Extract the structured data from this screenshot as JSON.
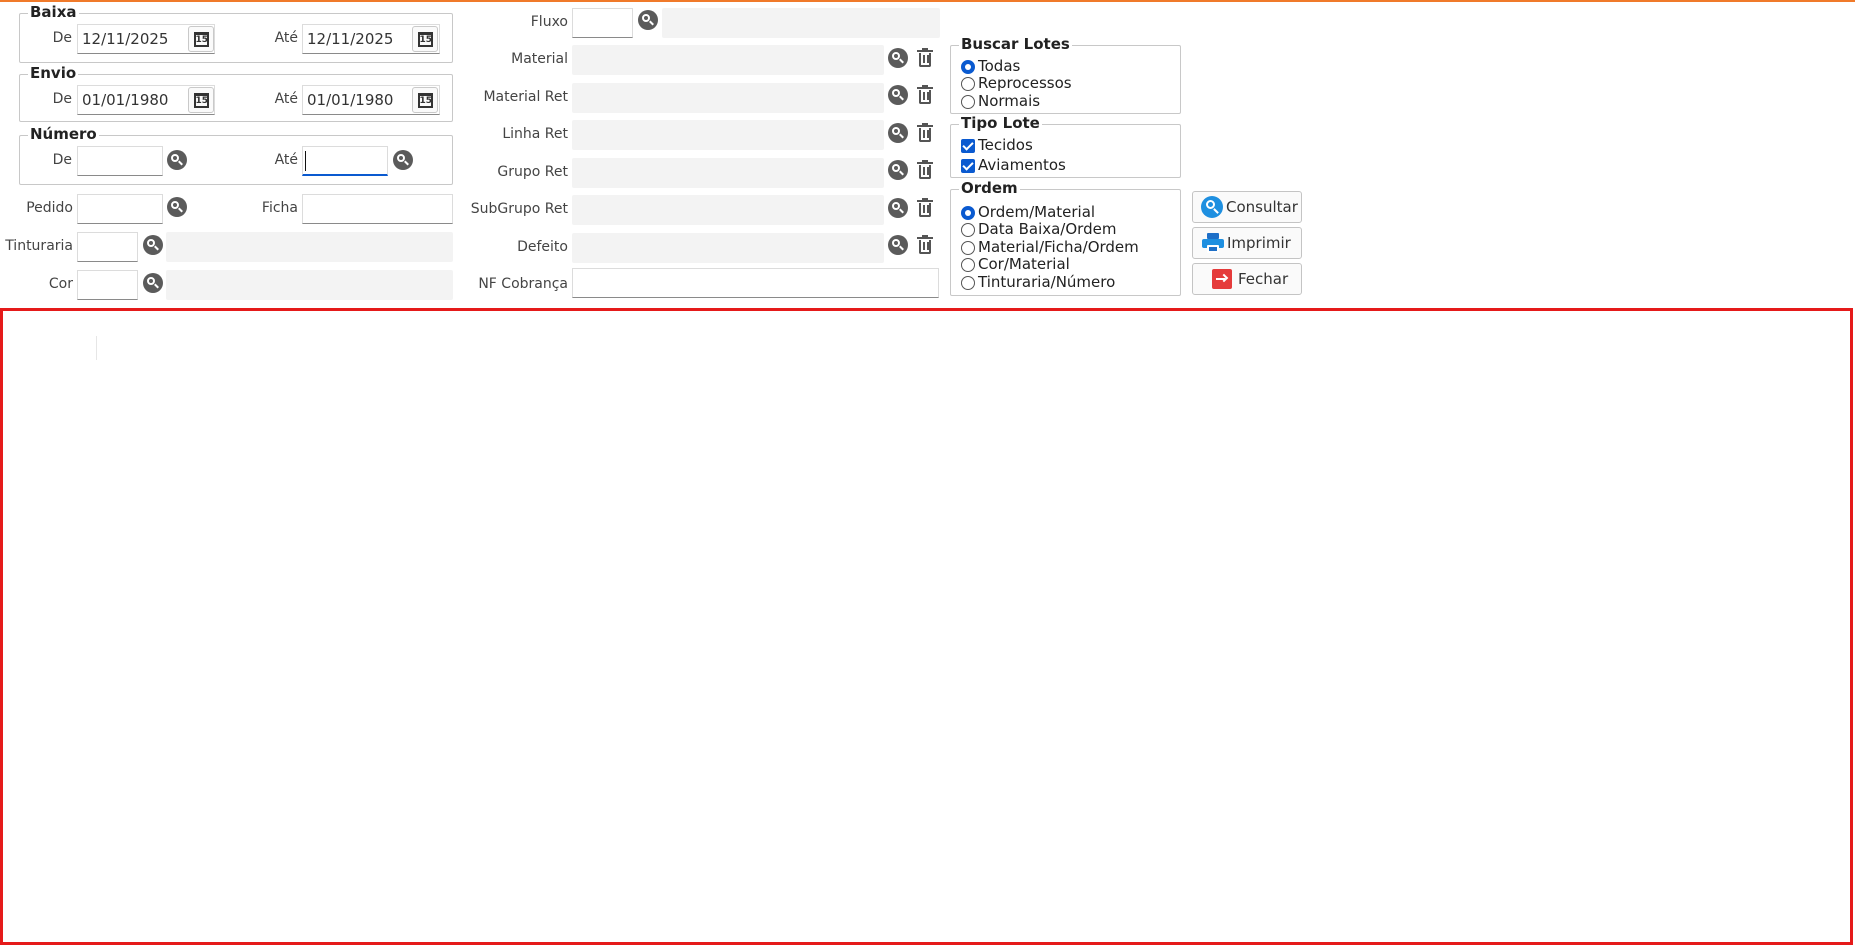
{
  "baixa": {
    "title": "Baixa",
    "de_label": "De",
    "de_value": "12/11/2025",
    "ate_label": "Até",
    "ate_value": "12/11/2025"
  },
  "envio": {
    "title": "Envio",
    "de_label": "De",
    "de_value": "01/01/1980",
    "ate_label": "Até",
    "ate_value": "01/01/1980"
  },
  "numero": {
    "title": "Número",
    "de_label": "De",
    "de_value": "",
    "ate_label": "Até",
    "ate_value": ""
  },
  "calendar_glyph": "15",
  "left_fields": {
    "pedido_label": "Pedido",
    "pedido_value": "",
    "ficha_label": "Ficha",
    "ficha_value": "",
    "tinturaria_label": "Tinturaria",
    "tinturaria_value": "",
    "cor_label": "Cor",
    "cor_value": ""
  },
  "middle_fields": {
    "fluxo_label": "Fluxo",
    "fluxo_value": "",
    "material_label": "Material",
    "material_ret_label": "Material Ret",
    "linha_ret_label": "Linha Ret",
    "grupo_ret_label": "Grupo Ret",
    "subgrupo_ret_label": "SubGrupo Ret",
    "defeito_label": "Defeito",
    "nf_cobranca_label": "NF Cobrança",
    "nf_cobranca_value": ""
  },
  "buscar_lotes": {
    "title": "Buscar Lotes",
    "options": [
      "Todas",
      "Reprocessos",
      "Normais"
    ],
    "selected": "Todas"
  },
  "tipo_lote": {
    "title": "Tipo Lote",
    "options": [
      "Tecidos",
      "Aviamentos"
    ],
    "checked": [
      "Tecidos",
      "Aviamentos"
    ]
  },
  "ordem": {
    "title": "Ordem",
    "options": [
      "Ordem/Material",
      "Data Baixa/Ordem",
      "Material/Ficha/Ordem",
      "Cor/Material",
      "Tinturaria/Número"
    ],
    "selected": "Ordem/Material"
  },
  "actions": {
    "consultar": "Consultar",
    "imprimir": "Imprimir",
    "fechar": "Fechar"
  },
  "colors": {
    "accent_top": "#f07a2a",
    "result_border": "#e51a1a",
    "primary": "#0a5ad0"
  }
}
